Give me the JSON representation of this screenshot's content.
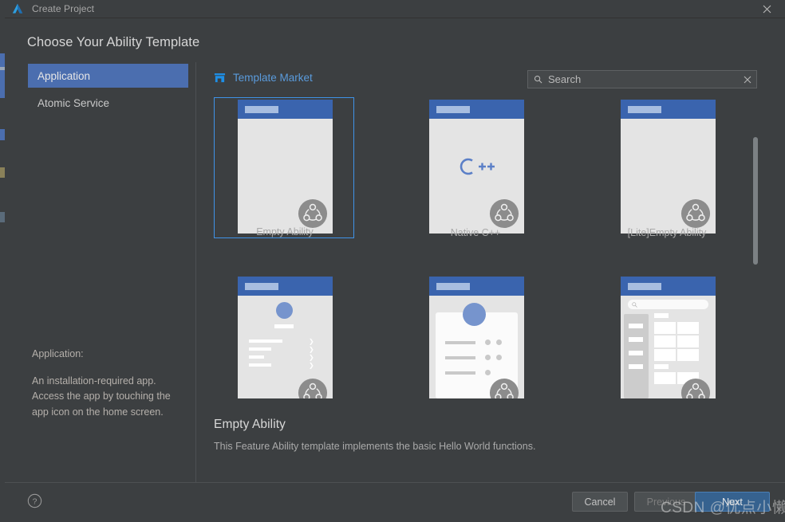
{
  "window": {
    "title": "Create Project",
    "logo_icon": "deveco-triangle-logo",
    "close_icon": "close-icon"
  },
  "page": {
    "title": "Choose Your Ability Template"
  },
  "sidebar": {
    "items": [
      {
        "label": "Application",
        "selected": true
      },
      {
        "label": "Atomic Service",
        "selected": false
      }
    ],
    "description": {
      "heading": "Application:",
      "lines": [
        "An installation-required app.",
        "Access the app by touching the",
        "app icon on the home screen."
      ]
    }
  },
  "market": {
    "icon": "storefront-icon",
    "label": "Template Market"
  },
  "search": {
    "icon": "search-icon",
    "placeholder": "Search",
    "value": "",
    "clear_icon": "close-icon"
  },
  "templates": [
    {
      "name": "Empty Ability",
      "art": "blank",
      "selected": true,
      "badge_icon": "harmony-distributed-icon"
    },
    {
      "name": "Native C++",
      "art": "cpp",
      "selected": false,
      "badge_icon": "harmony-distributed-icon",
      "logo_text": "C++"
    },
    {
      "name": "[Lite]Empty Ability",
      "art": "blank",
      "selected": false,
      "badge_icon": "harmony-distributed-icon"
    },
    {
      "name": "",
      "art": "profile",
      "selected": false,
      "badge_icon": "harmony-distributed-icon"
    },
    {
      "name": "",
      "art": "cardlist",
      "selected": false,
      "badge_icon": "harmony-distributed-icon"
    },
    {
      "name": "",
      "art": "catalog",
      "selected": false,
      "badge_icon": "harmony-distributed-icon"
    }
  ],
  "selection": {
    "title": "Empty Ability",
    "description": "This Feature Ability template implements the basic Hello World functions."
  },
  "footer": {
    "help_icon": "help-circle-icon",
    "cancel_label": "Cancel",
    "previous_label": "Previous",
    "next_label": "Next"
  },
  "watermark": {
    "text": "CSDN @优点小懒"
  },
  "colors": {
    "window_bg": "#3c3f41",
    "accent_blue": "#4b6eaf",
    "link_blue": "#5a9bdc",
    "selection_border": "#3f93e8",
    "thumb_header": "#3a64ae",
    "primary_button": "#36628f"
  }
}
